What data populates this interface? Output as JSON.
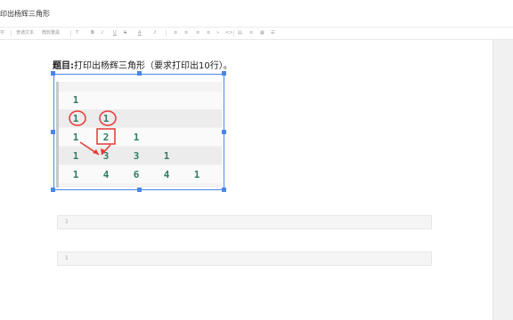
{
  "window": {
    "doc_title": "印出杨辉三角形"
  },
  "toolbar": {
    "items": [
      "字",
      "普通文本",
      "微软雅黑",
      "T",
      "B",
      "I",
      "U",
      "S",
      "A",
      "ℓ",
      "≡",
      "≡",
      "≡",
      "≡",
      "»",
      "<>",
      "▤",
      "≡",
      "▦",
      "☰"
    ]
  },
  "content": {
    "heading_label": "题目:",
    "heading_text": "打印出杨辉三角形（要求打印出10行）。"
  },
  "triangle": {
    "rows": [
      [
        "1"
      ],
      [
        "1",
        "1"
      ],
      [
        "1",
        "2",
        "1"
      ],
      [
        "1",
        "3",
        "3",
        "1"
      ],
      [
        "1",
        "4",
        "6",
        "4",
        "1"
      ]
    ]
  },
  "colors": {
    "selection": "#4a86e8",
    "annotation": "#e53935",
    "number": "#2e7d63"
  },
  "code_blocks": [
    {
      "line_number": "1"
    },
    {
      "line_number": "1"
    }
  ]
}
